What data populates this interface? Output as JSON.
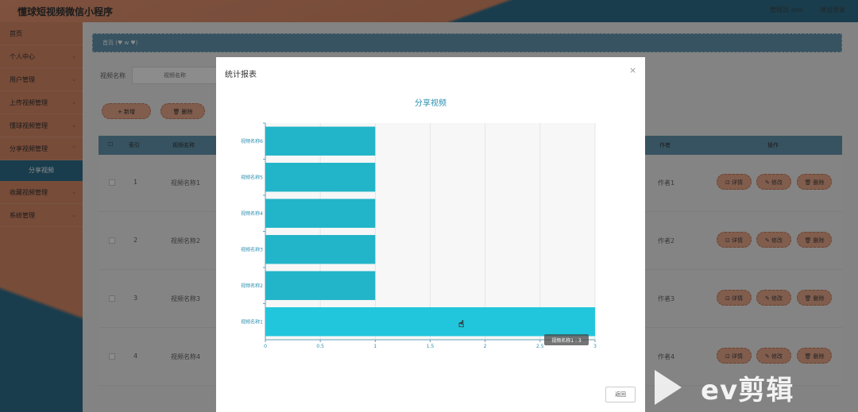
{
  "app": {
    "title": "懂球短视频微信小程序",
    "admin_text": "管理员 abo",
    "logout": "退出登录"
  },
  "sidebar": {
    "items": [
      {
        "label": "首页",
        "chev": ""
      },
      {
        "label": "个人中心",
        "chev": "⌄"
      },
      {
        "label": "用户管理",
        "chev": "⌄"
      },
      {
        "label": "上传视频管理",
        "chev": "⌄"
      },
      {
        "label": "懂球视频管理",
        "chev": "⌄"
      },
      {
        "label": "分享视频管理",
        "chev": "⌃"
      },
      {
        "label": "收藏视频管理",
        "chev": "⌄"
      },
      {
        "label": "系统管理",
        "chev": "⌄"
      }
    ],
    "sub_item": "分享视频"
  },
  "breadcrumb": "首页 (♥ w ♥)",
  "search": {
    "label": "视频名称",
    "placeholder": "视频名称"
  },
  "toolbar": {
    "add": "+ 新增",
    "delete": "🗑 删除"
  },
  "table": {
    "headers": {
      "index": "索引",
      "name": "视频名称",
      "author": "作者",
      "ops": "操作"
    },
    "rows": [
      {
        "index": "1",
        "name": "视频名称1",
        "author": "作者1"
      },
      {
        "index": "2",
        "name": "视频名称2",
        "author": "作者2"
      },
      {
        "index": "3",
        "name": "视频名称3",
        "author": "作者3"
      },
      {
        "index": "4",
        "name": "视频名称4",
        "author": "作者4"
      }
    ],
    "actions": {
      "detail": "⊡ 详情",
      "edit": "✎ 修改",
      "remove": "🗑 删除"
    }
  },
  "modal": {
    "title": "统计报表",
    "close": "×",
    "return_button": "返回"
  },
  "chart_data": {
    "type": "bar",
    "orientation": "horizontal",
    "title": "分享视频",
    "categories": [
      "视频名称1",
      "视频名称2",
      "视频名称3",
      "视频名称4",
      "视频名称5",
      "视频名称6"
    ],
    "values": [
      3,
      1,
      1,
      1,
      1,
      1
    ],
    "xlim": [
      0,
      3
    ],
    "xticks": [
      "0",
      "0.5",
      "1",
      "1.5",
      "2",
      "2.5",
      "3"
    ],
    "tooltip": "视频名称1 : 3",
    "bar_color": "#22b4c8",
    "highlight_color": "#22c6dc",
    "grid": true
  },
  "watermark": {
    "text": "ev剪辑"
  },
  "colors": {
    "accent": "#2f6f8d",
    "orange": "#d98a68",
    "chart_title": "#2a8fb0"
  }
}
